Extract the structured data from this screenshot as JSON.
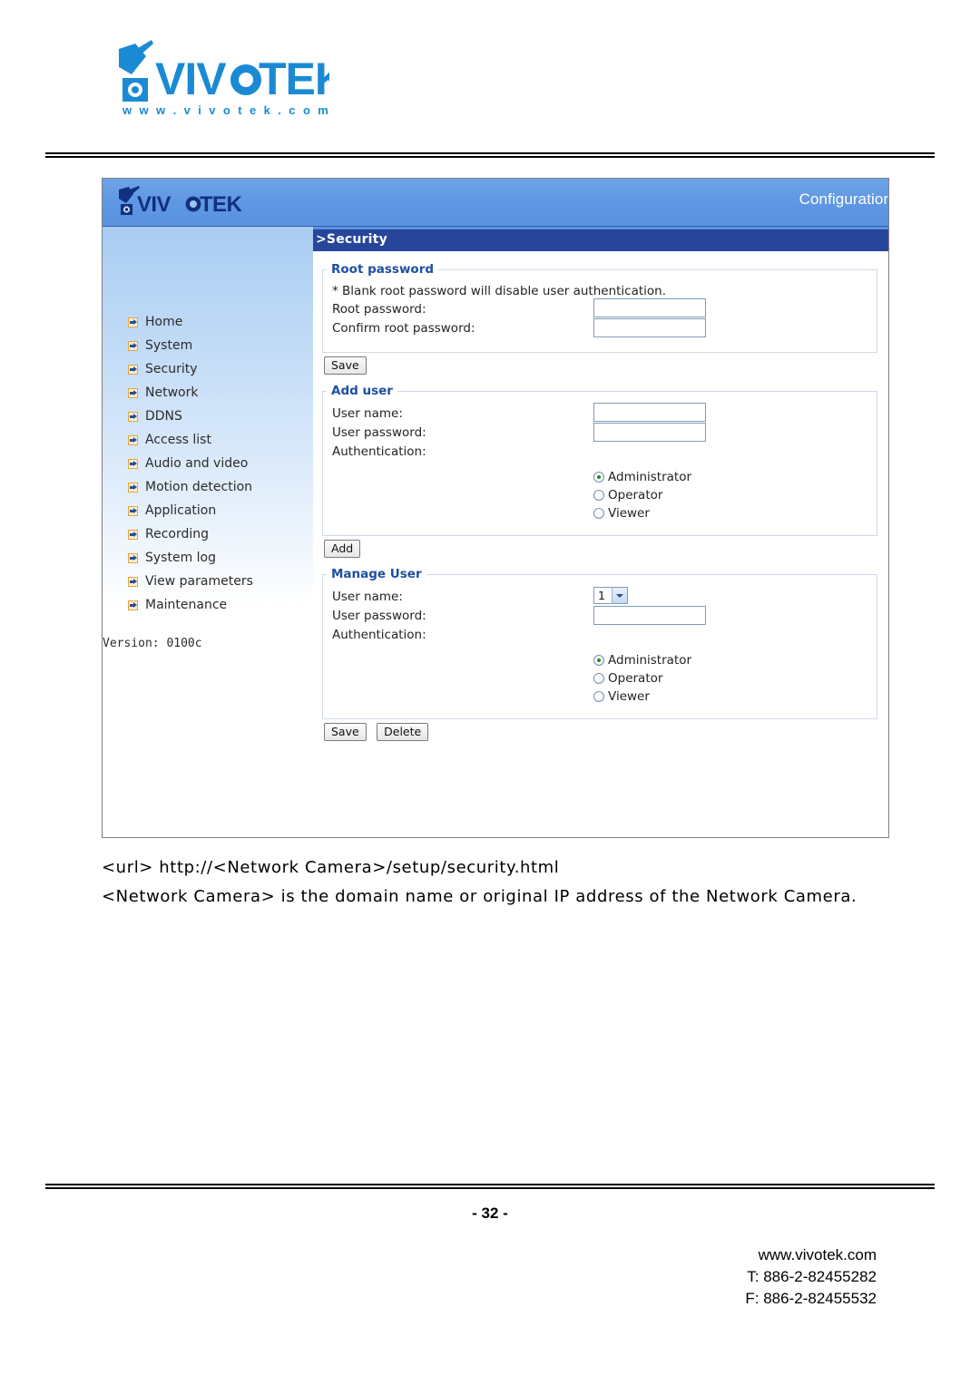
{
  "document": {
    "brand_logo_text": "VIVOTEK",
    "brand_logo_subtext": "w w w . v i v o t e k . c o m",
    "page_number": "- 32 -",
    "caption_url": "<url> http://<Network Camera>/setup/security.html",
    "caption_note": "<Network Camera> is the domain name or original IP address of the Network Camera.",
    "footer": {
      "website": "www.vivotek.com",
      "phone": "T: 886-2-82455282",
      "fax": "F: 886-2-82455532"
    }
  },
  "screenshot": {
    "header": {
      "logo_text": "VIVOTEK",
      "right_label": "Configuration"
    },
    "page_title": ">Security",
    "sidebar": {
      "items": [
        {
          "label": "Home"
        },
        {
          "label": "System"
        },
        {
          "label": "Security"
        },
        {
          "label": "Network"
        },
        {
          "label": "DDNS"
        },
        {
          "label": "Access list"
        },
        {
          "label": "Audio and video"
        },
        {
          "label": "Motion detection"
        },
        {
          "label": "Application"
        },
        {
          "label": "Recording"
        },
        {
          "label": "System log"
        },
        {
          "label": "View parameters"
        },
        {
          "label": "Maintenance"
        }
      ],
      "version": "Version: 0100c"
    },
    "root_password": {
      "legend": "Root password",
      "note": "* Blank root password will disable user authentication.",
      "root_password_label": "Root password:",
      "root_password_value": "",
      "confirm_label": "Confirm root password:",
      "confirm_value": "",
      "save_label": "Save"
    },
    "add_user": {
      "legend": "Add user",
      "user_name_label": "User name:",
      "user_name_value": "",
      "user_password_label": "User password:",
      "user_password_value": "",
      "authentication_label": "Authentication:",
      "options": [
        {
          "label": "Administrator",
          "selected": true
        },
        {
          "label": "Operator",
          "selected": false
        },
        {
          "label": "Viewer",
          "selected": false
        }
      ],
      "add_label": "Add"
    },
    "manage_user": {
      "legend": "Manage User",
      "user_name_label": "User name:",
      "user_name_selected": "1",
      "user_password_label": "User password:",
      "user_password_value": "",
      "authentication_label": "Authentication:",
      "options": [
        {
          "label": "Administrator",
          "selected": true
        },
        {
          "label": "Operator",
          "selected": false
        },
        {
          "label": "Viewer",
          "selected": false
        }
      ],
      "save_label": "Save",
      "delete_label": "Delete"
    }
  },
  "colors": {
    "brand_blue": "#1b8ad4",
    "header_blue": "#5d96e2",
    "title_navy": "#27469b",
    "legend_blue": "#1d4fa0",
    "radio_green": "#1f8c1f",
    "nav_icon_orange": "#e8a33d"
  }
}
